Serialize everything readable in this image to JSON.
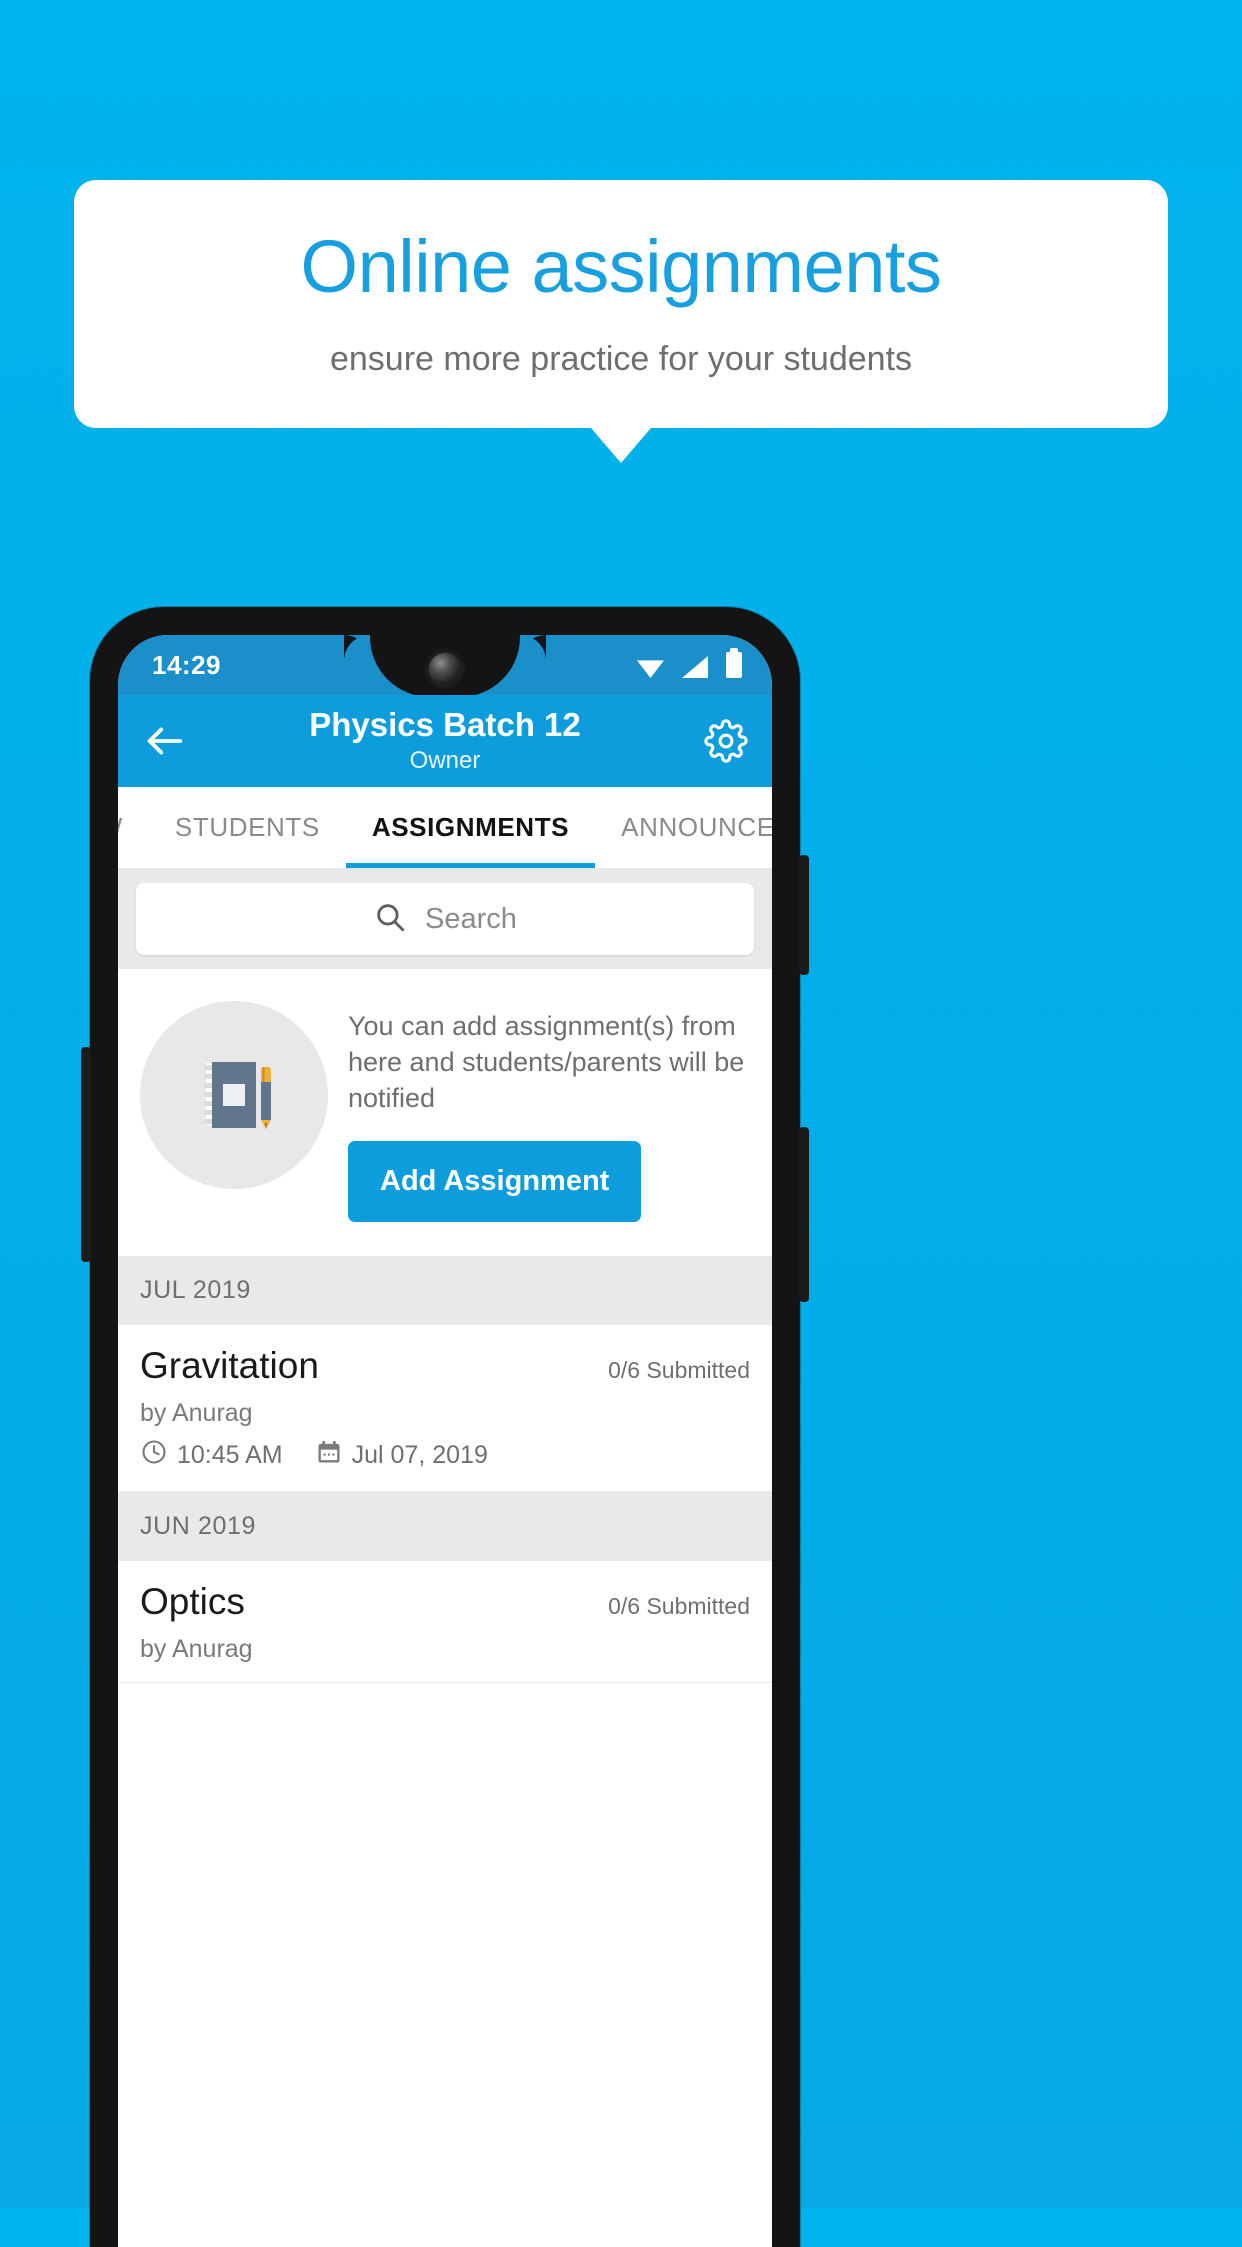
{
  "promo": {
    "title": "Online assignments",
    "subtitle": "ensure more practice for your students",
    "accent_color": "#189fe0",
    "background_color": "#03afe9"
  },
  "status_bar": {
    "time": "14:29",
    "icons": [
      "wifi-icon",
      "signal-icon",
      "battery-icon"
    ]
  },
  "app_bar": {
    "back_icon": "back-arrow-icon",
    "title": "Physics Batch 12",
    "subtitle": "Owner",
    "settings_icon": "gear-icon",
    "color": "#0d9ddd"
  },
  "tabs": [
    {
      "label": "IEW",
      "active": false
    },
    {
      "label": "STUDENTS",
      "active": false
    },
    {
      "label": "ASSIGNMENTS",
      "active": true
    },
    {
      "label": "ANNOUNCEM",
      "active": false
    }
  ],
  "search": {
    "placeholder": "Search",
    "icon": "search-icon",
    "value": ""
  },
  "empty_state": {
    "illustration": "notebook-pen-icon",
    "text": "You can add assignment(s) from here and students/parents will be notified",
    "button_label": "Add Assignment"
  },
  "sections": [
    {
      "month": "JUL 2019",
      "items": [
        {
          "title": "Gravitation",
          "submitted": "0/6 Submitted",
          "author": "by Anurag",
          "time": "10:45 AM",
          "date": "Jul 07, 2019",
          "time_icon": "clock-icon",
          "date_icon": "calendar-icon"
        }
      ]
    },
    {
      "month": "JUN 2019",
      "items": [
        {
          "title": "Optics",
          "submitted": "0/6 Submitted",
          "author": "by Anurag",
          "time": "",
          "date": "",
          "time_icon": "clock-icon",
          "date_icon": "calendar-icon"
        }
      ]
    }
  ]
}
